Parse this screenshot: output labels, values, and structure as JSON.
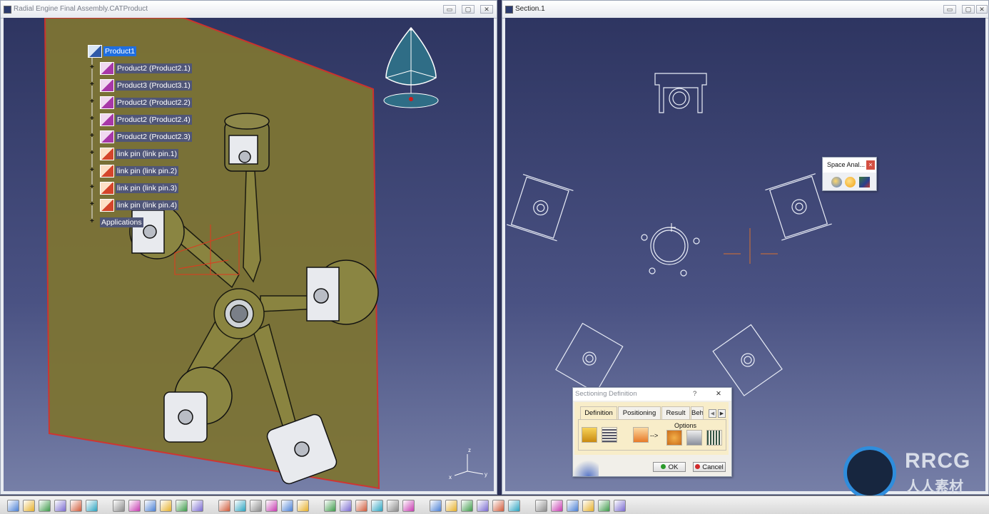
{
  "left_window": {
    "title": "Radial Engine Final Assembly.CATProduct",
    "controls": {
      "minimize": "▭",
      "restore": "▢",
      "close": "✕"
    },
    "tree": [
      {
        "label": "Product1",
        "icon": "product-icon",
        "selected": true
      },
      {
        "label": "Product2 (Product2.1)",
        "icon": "subproduct-icon"
      },
      {
        "label": "Product3 (Product3.1)",
        "icon": "subproduct-icon"
      },
      {
        "label": "Product2 (Product2.2)",
        "icon": "subproduct-icon"
      },
      {
        "label": "Product2 (Product2.4)",
        "icon": "subproduct-icon"
      },
      {
        "label": "Product2 (Product2.3)",
        "icon": "subproduct-icon"
      },
      {
        "label": "link pin (link pin.1)",
        "icon": "part-icon"
      },
      {
        "label": "link pin (link pin.2)",
        "icon": "part-icon"
      },
      {
        "label": "link pin (link pin.3)",
        "icon": "part-icon"
      },
      {
        "label": "link pin (link pin.4)",
        "icon": "part-icon"
      },
      {
        "label": "Applications",
        "icon": "applications-icon"
      }
    ],
    "axis_labels": {
      "z": "z",
      "x": "x",
      "y": "y"
    }
  },
  "right_window": {
    "title": "Section.1",
    "controls": {
      "minimize": "▭",
      "restore": "▢",
      "close": "✕"
    }
  },
  "space_analysis_toolbar": {
    "title": "Space Anal...",
    "close": "×",
    "icons": [
      "clash-icon",
      "sectioning-icon",
      "distance-icon"
    ]
  },
  "sectioning_dialog": {
    "title": "Sectioning Definition",
    "help": "?",
    "close": "✕",
    "tabs": [
      "Definition",
      "Positioning",
      "Result",
      "Beh"
    ],
    "arrow_text": "-->",
    "options_label": "Options",
    "ok_label": "OK",
    "cancel_label": "Cancel"
  },
  "watermark": {
    "brand": "RRCG",
    "subtitle": "人人素材"
  },
  "colors": {
    "viewport_top": "#2e3561",
    "viewport_bottom": "#767fa7",
    "plane_fill": "#7d7434",
    "plane_border": "#d4322c",
    "selection": "#1f6ee0",
    "section_line": "#e8ecf6"
  }
}
